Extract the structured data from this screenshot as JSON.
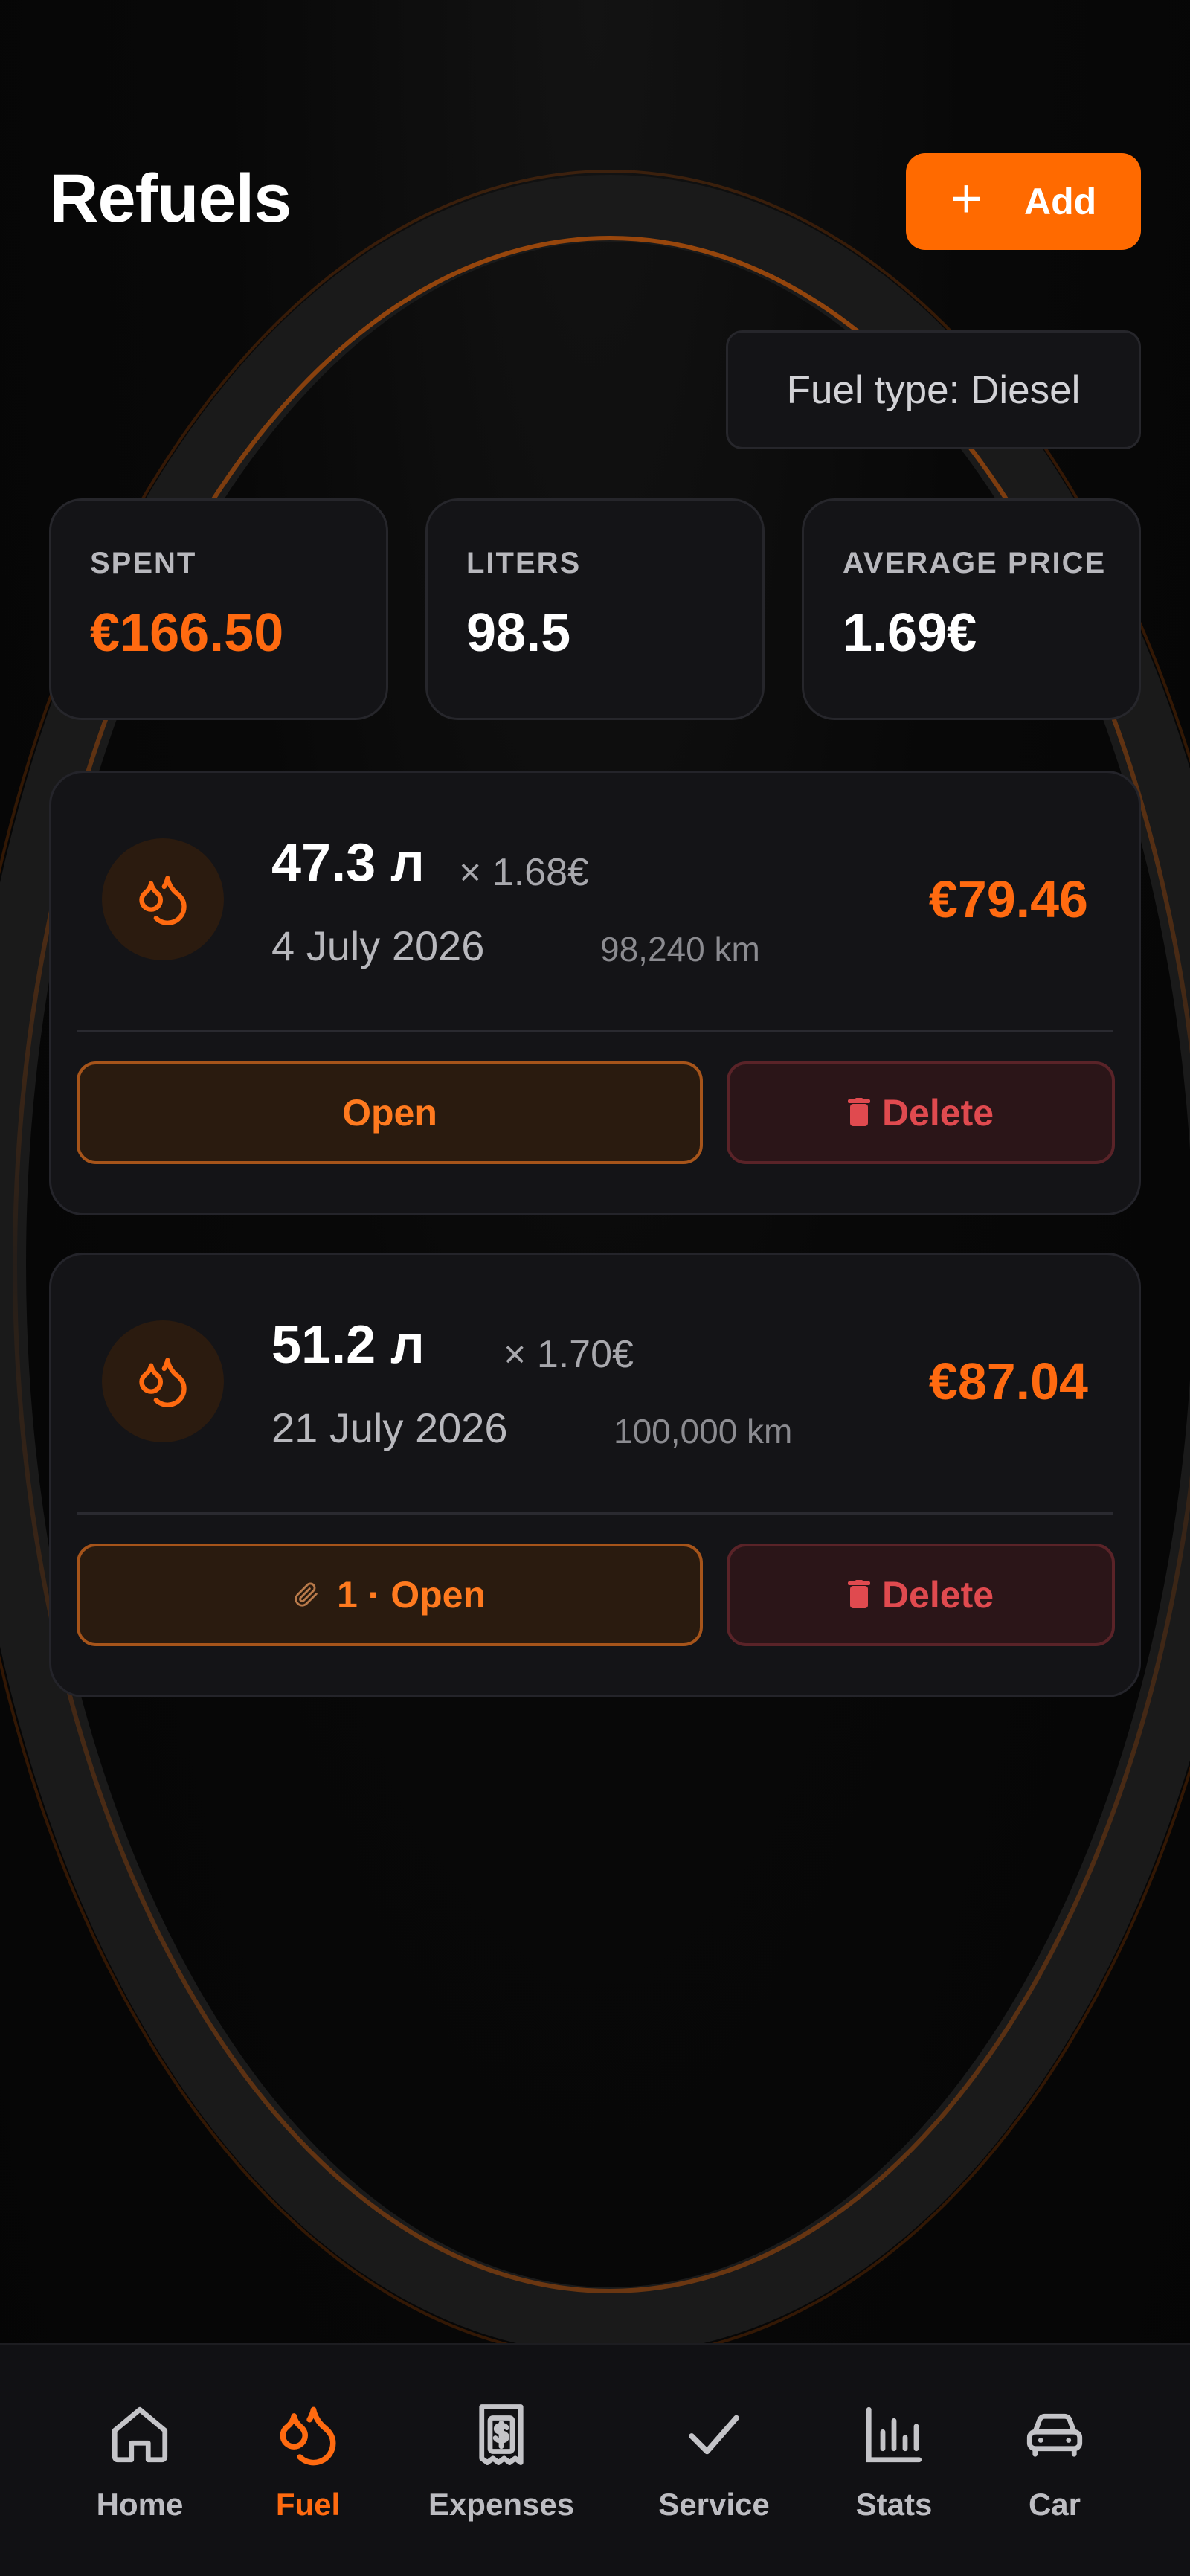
{
  "header": {
    "title": "Refuels",
    "add_label": "Add"
  },
  "filter": {
    "fuel_type_label": "Fuel type: Diesel"
  },
  "stats": [
    {
      "label": "SPENT",
      "value": "€166.50"
    },
    {
      "label": "LITERS",
      "value": "98.5"
    },
    {
      "label": "AVERAGE PRICE",
      "value": "1.69€"
    }
  ],
  "refuels": [
    {
      "liters": "47.3 л",
      "price": "× 1.68€",
      "date": "4 July 2026",
      "km": "98,240 km",
      "total": "€79.46",
      "open_label": "Open",
      "delete_label": "Delete"
    },
    {
      "liters": "51.2 л",
      "price": "× 1.70€",
      "date": "21 July 2026",
      "km": "100,000 km",
      "total": "€87.04",
      "open_label": "1 · Open",
      "delete_label": "Delete"
    }
  ],
  "nav": [
    {
      "label": "Home",
      "icon": "home-icon"
    },
    {
      "label": "Fuel",
      "icon": "fuel-drop-icon",
      "active": true
    },
    {
      "label": "Expenses",
      "icon": "receipt-icon"
    },
    {
      "label": "Service",
      "icon": "check-icon"
    },
    {
      "label": "Stats",
      "icon": "bar-chart-icon"
    },
    {
      "label": "Car",
      "icon": "car-icon"
    }
  ],
  "colors": {
    "accent": "#ff6a00",
    "danger": "#e04a4f",
    "card_bg": "#141417",
    "page_bg": "#070707"
  }
}
